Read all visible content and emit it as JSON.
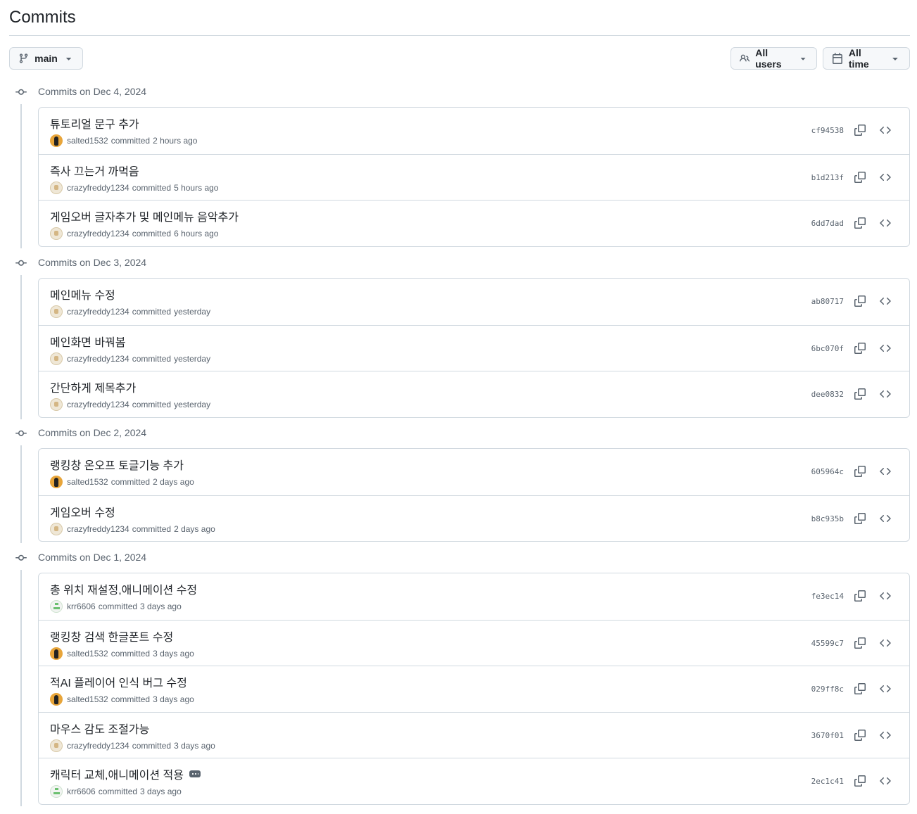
{
  "header": {
    "title": "Commits"
  },
  "filters": {
    "branch_label": "main",
    "users_label": "All users",
    "time_label": "All time"
  },
  "colors": {
    "border": "#d1d9e0",
    "muted_text": "#59636e",
    "text": "#1f2328",
    "button_bg": "#f6f8fa"
  },
  "groups": [
    {
      "title": "Commits on Dec 4, 2024",
      "commits": [
        {
          "message": "튜토리얼 문구 추가",
          "author": "salted1532",
          "verb": "committed",
          "time": "2 hours ago",
          "sha": "cf94538",
          "avatar": "salted"
        },
        {
          "message": "즉사 끄는거 까먹음",
          "author": "crazyfreddy1234",
          "verb": "committed",
          "time": "5 hours ago",
          "sha": "b1d213f",
          "avatar": "crazy"
        },
        {
          "message": "게임오버 글자추가 및 메인메뉴 음악추가",
          "author": "crazyfreddy1234",
          "verb": "committed",
          "time": "6 hours ago",
          "sha": "6dd7dad",
          "avatar": "crazy"
        }
      ]
    },
    {
      "title": "Commits on Dec 3, 2024",
      "commits": [
        {
          "message": "메인메뉴 수정",
          "author": "crazyfreddy1234",
          "verb": "committed",
          "time": "yesterday",
          "sha": "ab80717",
          "avatar": "crazy"
        },
        {
          "message": "메인화면 바꿔봄",
          "author": "crazyfreddy1234",
          "verb": "committed",
          "time": "yesterday",
          "sha": "6bc070f",
          "avatar": "crazy"
        },
        {
          "message": "간단하게 제목추가",
          "author": "crazyfreddy1234",
          "verb": "committed",
          "time": "yesterday",
          "sha": "dee0832",
          "avatar": "crazy"
        }
      ]
    },
    {
      "title": "Commits on Dec 2, 2024",
      "commits": [
        {
          "message": "랭킹창 온오프 토글기능 추가",
          "author": "salted1532",
          "verb": "committed",
          "time": "2 days ago",
          "sha": "605964c",
          "avatar": "salted"
        },
        {
          "message": "게임오버 수정",
          "author": "crazyfreddy1234",
          "verb": "committed",
          "time": "2 days ago",
          "sha": "b8c935b",
          "avatar": "crazy"
        }
      ]
    },
    {
      "title": "Commits on Dec 1, 2024",
      "commits": [
        {
          "message": "총 위치 재설정,애니메이션 수정",
          "author": "krr6606",
          "verb": "committed",
          "time": "3 days ago",
          "sha": "fe3ec14",
          "avatar": "krr"
        },
        {
          "message": "랭킹창 검색 한글폰트 수정",
          "author": "salted1532",
          "verb": "committed",
          "time": "3 days ago",
          "sha": "45599c7",
          "avatar": "salted"
        },
        {
          "message": "적AI 플레이어 인식 버그 수정",
          "author": "salted1532",
          "verb": "committed",
          "time": "3 days ago",
          "sha": "029ff8c",
          "avatar": "salted"
        },
        {
          "message": "마우스 감도 조절가능",
          "author": "crazyfreddy1234",
          "verb": "committed",
          "time": "3 days ago",
          "sha": "3670f01",
          "avatar": "crazy"
        },
        {
          "message": "캐릭터 교체,애니메이션 적용",
          "author": "krr6606",
          "verb": "committed",
          "time": "3 days ago",
          "sha": "2ec1c41",
          "avatar": "krr",
          "has_description": true
        }
      ]
    }
  ]
}
